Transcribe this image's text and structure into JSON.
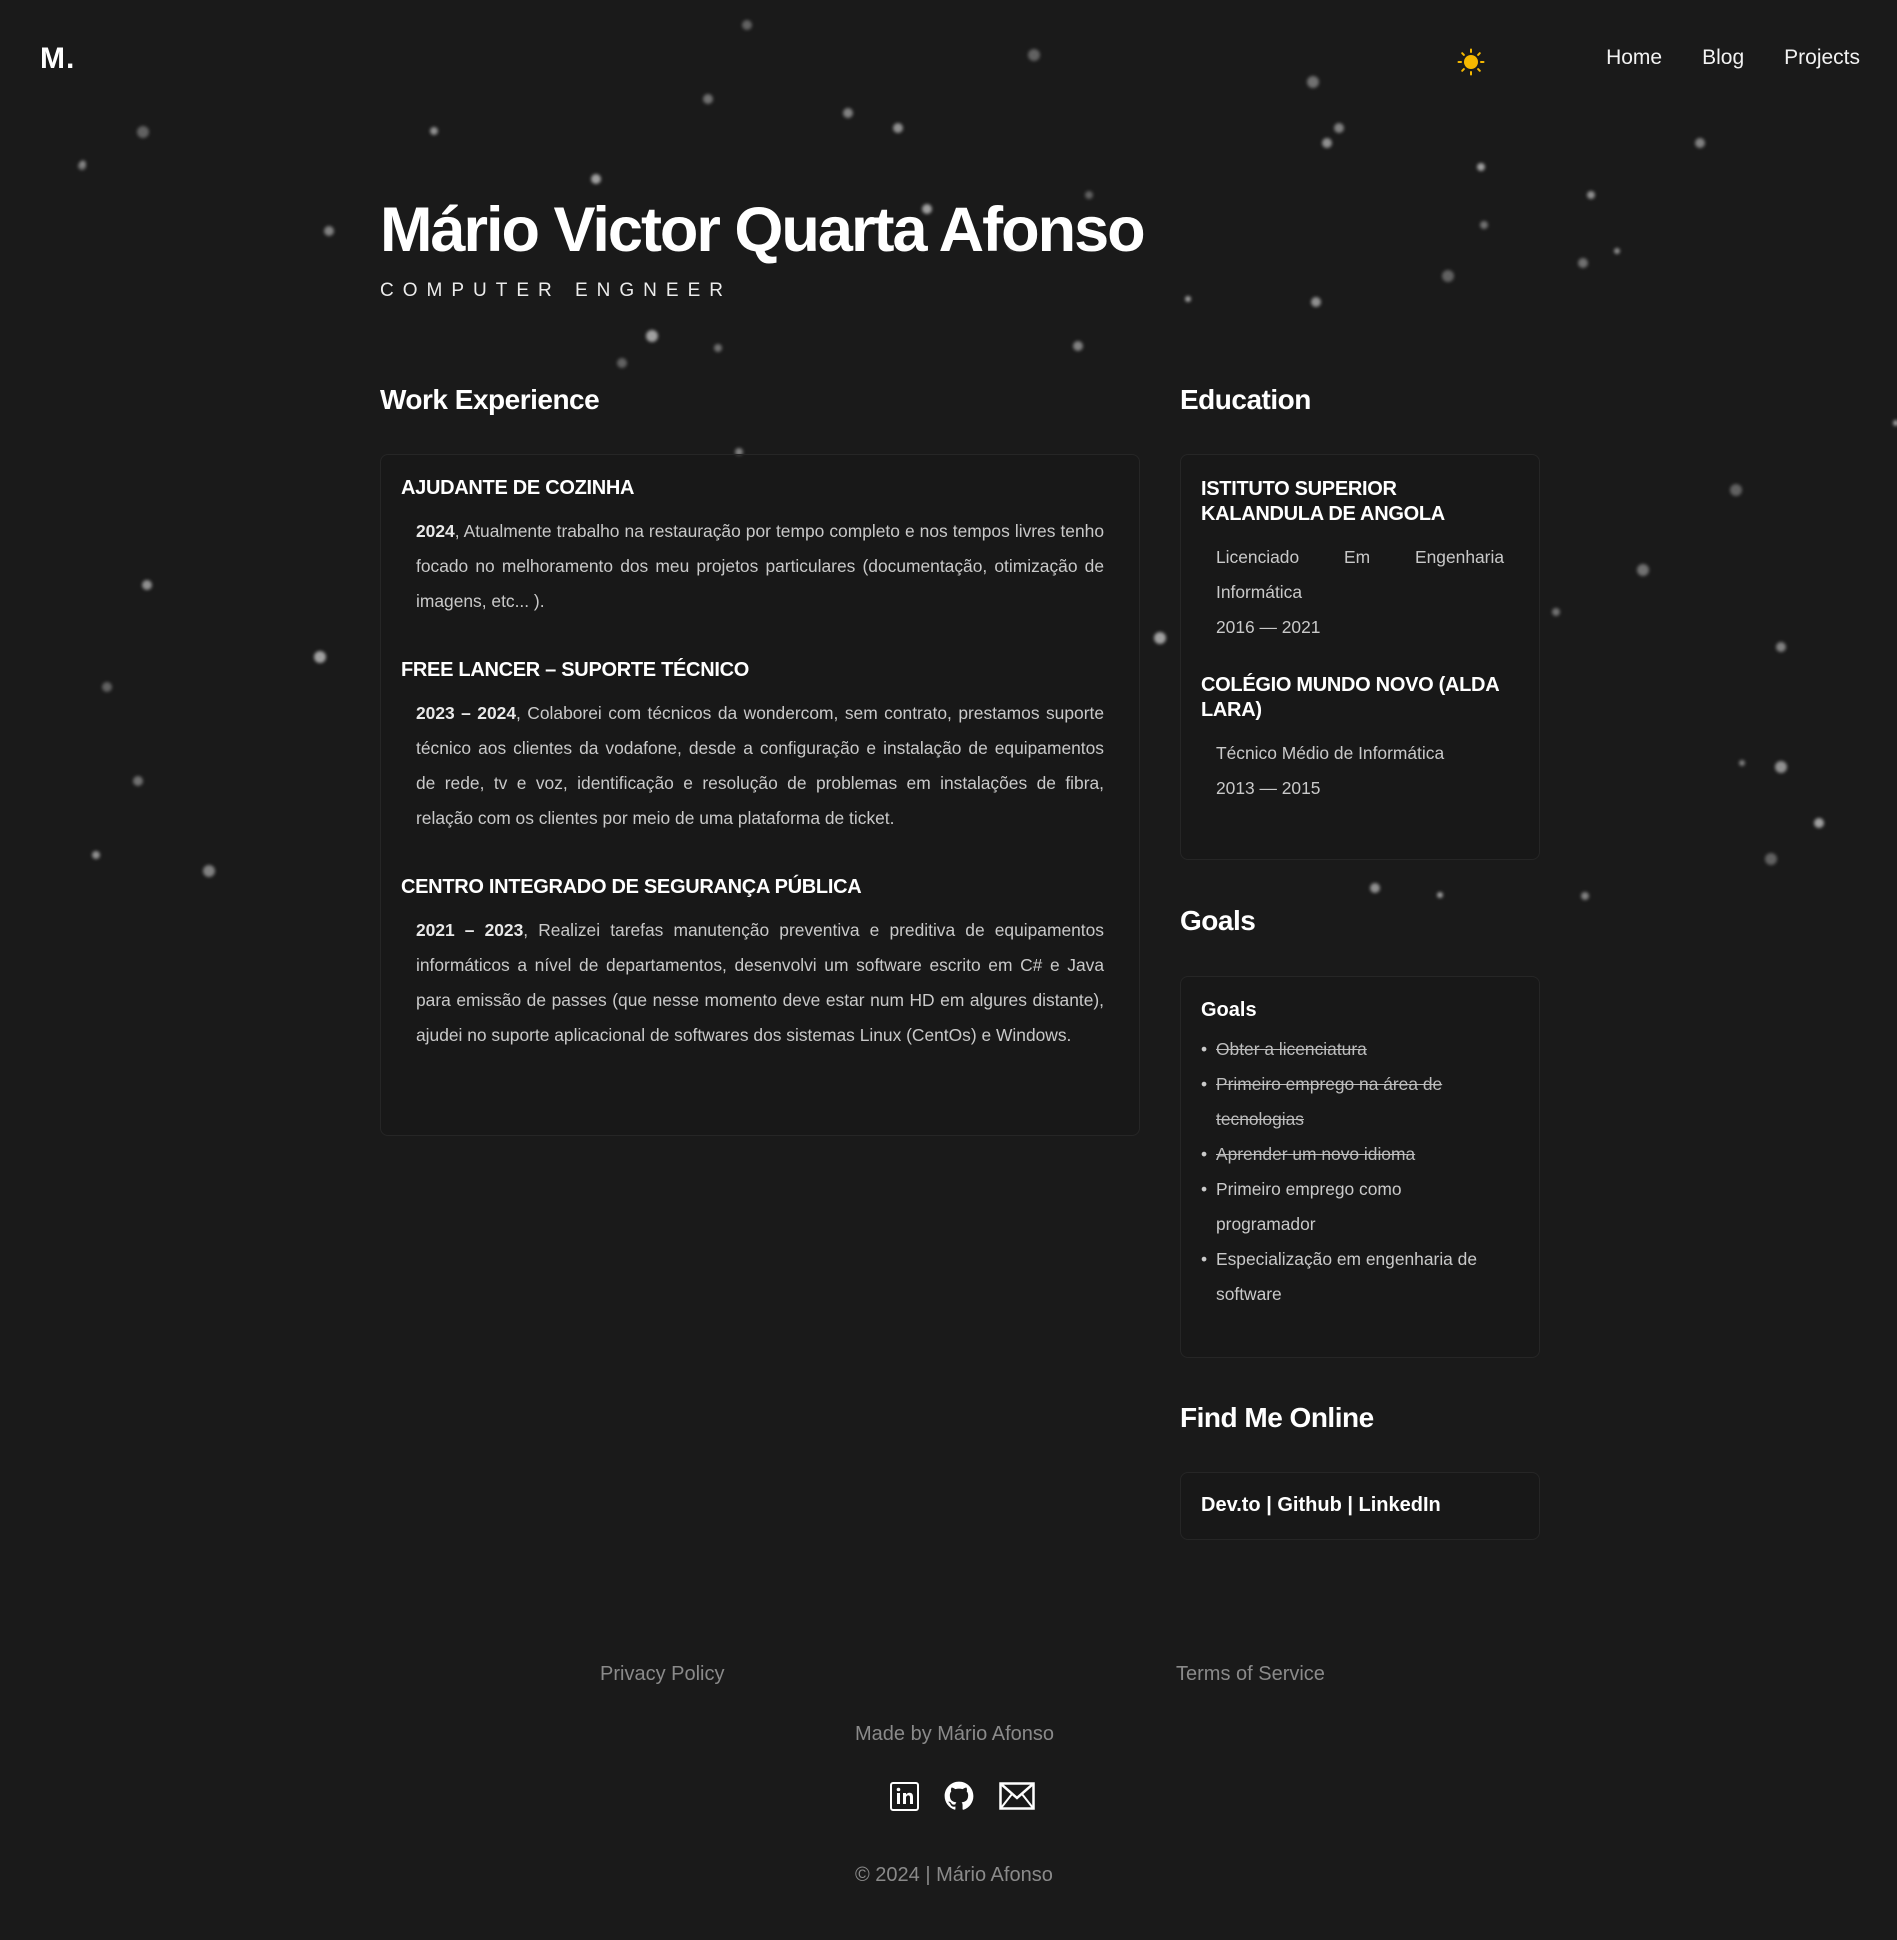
{
  "header": {
    "logo": "M.",
    "nav": [
      "Home",
      "Blog",
      "Projects"
    ],
    "theme_icon": "sun-icon",
    "theme_color": "#f5b800"
  },
  "hero": {
    "name": "Mário Victor Quarta Afonso",
    "subtitle": "COMPUTER ENGNEER"
  },
  "work": {
    "title": "Work Experience",
    "jobs": [
      {
        "title": "AJUDANTE DE COZINHA",
        "period": "2024",
        "description": ", Atualmente trabalho na restauração por tempo completo e nos tempos livres tenho focado no melhoramento dos meu projetos particulares (documentação, otimização de imagens, etc... )."
      },
      {
        "title": "FREE LANCER – SUPORTE TÉCNICO",
        "period": "2023 – 2024",
        "description": ", Colaborei com técnicos da wondercom, sem contrato, prestamos suporte técnico aos clientes da vodafone, desde a configuração e instalação de equipamentos de rede, tv e voz, identificação e resolução de problemas em instalações de fibra, relação com os clientes por meio de uma plataforma de ticket."
      },
      {
        "title": "CENTRO INTEGRADO DE SEGURANÇA PÚBLICA",
        "period": "2021 – 2023",
        "description": ", Realizei tarefas manutenção preventiva e preditiva de equipamentos informáticos a nível de departamentos, desenvolvi um software escrito em C# e Java para emissão de passes (que nesse momento deve estar num HD em algures distante), ajudei no suporte aplicacional de softwares dos sistemas Linux (CentOs) e Windows."
      }
    ]
  },
  "education": {
    "title": "Education",
    "items": [
      {
        "school": "ISTITUTO SUPERIOR KALANDULA DE ANGOLA",
        "degree": "Licenciado Em Engenharia Informática",
        "years": "2016 — 2021"
      },
      {
        "school": "COLÉGIO MUNDO NOVO (ALDA LARA)",
        "degree": "Técnico Médio de Informática",
        "years": "2013 — 2015"
      }
    ]
  },
  "goals": {
    "title": "Goals",
    "heading": "Goals",
    "items": [
      {
        "text": "Obter a licenciatura",
        "done": true
      },
      {
        "text": "Primeiro emprego na área de tecnologias",
        "done": true
      },
      {
        "text": "Aprender um novo idioma",
        "done": true
      },
      {
        "text": "Primeiro emprego como programador",
        "done": false
      },
      {
        "text": "Especialização em engenharia de software",
        "done": false
      }
    ]
  },
  "online": {
    "title": "Find Me Online",
    "links": [
      "Dev.to",
      "Github",
      "LinkedIn"
    ],
    "separator": " | "
  },
  "footer": {
    "privacy": "Privacy Policy",
    "terms": "Terms of Service",
    "made_by": "Made by Mário Afonso",
    "copyright": "© 2024 | Mário Afonso",
    "social_icons": [
      "linkedin-icon",
      "github-icon",
      "mail-icon"
    ]
  }
}
